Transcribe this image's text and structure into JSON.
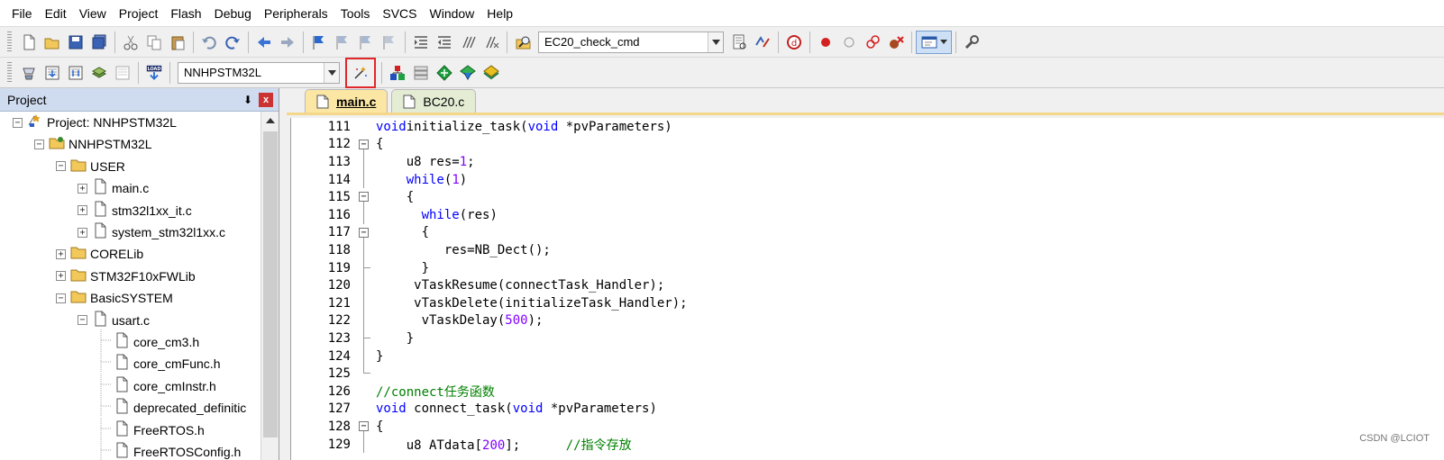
{
  "menubar": [
    "File",
    "Edit",
    "View",
    "Project",
    "Flash",
    "Debug",
    "Peripherals",
    "Tools",
    "SVCS",
    "Window",
    "Help"
  ],
  "toolbar1": {
    "target_combo": "EC20_check_cmd",
    "icons_left": [
      "new-file-icon",
      "open-folder-icon",
      "save-icon",
      "save-all-icon",
      "cut-icon",
      "copy-icon",
      "paste-icon",
      "undo-icon",
      "redo-icon",
      "navigate-back-icon",
      "navigate-forward-icon",
      "bookmark-set-icon",
      "bookmark-prev-icon",
      "bookmark-next-icon",
      "bookmark-clear-icon",
      "indent-icon",
      "unindent-icon",
      "comment-icon",
      "uncomment-icon",
      "find-in-files-icon"
    ],
    "icons_right": [
      "incremental-find-icon",
      "find-replace-icon",
      "debug-session-icon",
      "breakpoint-insert-icon",
      "breakpoint-disable-icon",
      "breakpoint-disable-all-icon",
      "breakpoint-kill-all-icon",
      "window-layout-icon",
      "configure-icon"
    ]
  },
  "toolbar2": {
    "target_combo": "NNHPSTM32L",
    "load_label": "LOAD",
    "icons_left": [
      "translate-icon",
      "build-icon",
      "rebuild-icon",
      "batch-build-icon",
      "stop-build-icon",
      "download-icon"
    ],
    "icons_right": [
      "options-for-target-icon",
      "manage-project-items-icon",
      "manage-run-time-environment-icon",
      "select-software-packs-icon",
      "pack-installer-icon",
      "books-icon"
    ]
  },
  "project": {
    "title": "Project",
    "pin": "⬇",
    "close": "x",
    "items": [
      {
        "label": "Project: NNHPSTM32L",
        "level": 0,
        "toggle": "-",
        "icon": "project-icon"
      },
      {
        "label": "NNHPSTM32L",
        "level": 1,
        "toggle": "-",
        "icon": "target-icon"
      },
      {
        "label": "USER",
        "level": 2,
        "toggle": "-",
        "icon": "folder-icon"
      },
      {
        "label": "main.c",
        "level": 3,
        "toggle": "+",
        "icon": "file-icon"
      },
      {
        "label": "stm32l1xx_it.c",
        "level": 3,
        "toggle": "+",
        "icon": "file-icon"
      },
      {
        "label": "system_stm32l1xx.c",
        "level": 3,
        "toggle": "+",
        "icon": "file-icon"
      },
      {
        "label": "CORELib",
        "level": 2,
        "toggle": "+",
        "icon": "folder-icon"
      },
      {
        "label": "STM32F10xFWLib",
        "level": 2,
        "toggle": "+",
        "icon": "folder-icon"
      },
      {
        "label": "BasicSYSTEM",
        "level": 2,
        "toggle": "-",
        "icon": "folder-icon"
      },
      {
        "label": "usart.c",
        "level": 3,
        "toggle": "-",
        "icon": "file-icon"
      },
      {
        "label": "core_cm3.h",
        "level": 4,
        "toggle": "",
        "icon": "header-file-icon"
      },
      {
        "label": "core_cmFunc.h",
        "level": 4,
        "toggle": "",
        "icon": "header-file-icon"
      },
      {
        "label": "core_cmInstr.h",
        "level": 4,
        "toggle": "",
        "icon": "header-file-icon"
      },
      {
        "label": "deprecated_definitic",
        "level": 4,
        "toggle": "",
        "icon": "header-file-icon"
      },
      {
        "label": "FreeRTOS.h",
        "level": 4,
        "toggle": "",
        "icon": "header-file-icon"
      },
      {
        "label": "FreeRTOSConfig.h",
        "level": 4,
        "toggle": "",
        "icon": "header-file-icon"
      }
    ]
  },
  "tabs": [
    {
      "label": "main.c",
      "active": true
    },
    {
      "label": "BC20.c",
      "active": false
    }
  ],
  "code": [
    {
      "n": "111",
      "fold": "",
      "t": [
        [
          "kw",
          "void"
        ],
        [
          "",
          "initialize_task("
        ],
        [
          "kw",
          "void"
        ],
        [
          "",
          " *pvParameters)"
        ]
      ]
    },
    {
      "n": "112",
      "fold": "open",
      "t": [
        [
          "",
          "{"
        ]
      ]
    },
    {
      "n": "113",
      "fold": "line",
      "t": [
        [
          "",
          "    u8 res="
        ],
        [
          "num",
          "1"
        ],
        [
          "",
          ";"
        ]
      ]
    },
    {
      "n": "114",
      "fold": "line",
      "t": [
        [
          "",
          "    "
        ],
        [
          "kw",
          "while"
        ],
        [
          "",
          "("
        ],
        [
          "num",
          "1"
        ],
        [
          "",
          ")"
        ]
      ]
    },
    {
      "n": "115",
      "fold": "open",
      "t": [
        [
          "",
          "    {"
        ]
      ]
    },
    {
      "n": "116",
      "fold": "line",
      "t": [
        [
          "",
          "      "
        ],
        [
          "kw",
          "while"
        ],
        [
          "",
          "(res)"
        ]
      ]
    },
    {
      "n": "117",
      "fold": "open",
      "t": [
        [
          "",
          "      {"
        ]
      ]
    },
    {
      "n": "118",
      "fold": "line",
      "t": [
        [
          "",
          "         res=NB_Dect();"
        ]
      ]
    },
    {
      "n": "119",
      "fold": "end",
      "t": [
        [
          "",
          "      }"
        ]
      ]
    },
    {
      "n": "120",
      "fold": "line",
      "t": [
        [
          "",
          "     vTaskResume(connectTask_Handler);"
        ]
      ]
    },
    {
      "n": "121",
      "fold": "line",
      "t": [
        [
          "",
          "     vTaskDelete(initializeTask_Handler);"
        ]
      ]
    },
    {
      "n": "122",
      "fold": "line",
      "t": [
        [
          "",
          "      vTaskDelay("
        ],
        [
          "num",
          "500"
        ],
        [
          "",
          ");"
        ]
      ]
    },
    {
      "n": "123",
      "fold": "end",
      "t": [
        [
          "",
          "    }"
        ]
      ]
    },
    {
      "n": "124",
      "fold": "line",
      "t": [
        [
          "",
          "}"
        ]
      ]
    },
    {
      "n": "125",
      "fold": "endlast",
      "t": []
    },
    {
      "n": "126",
      "fold": "",
      "t": [
        [
          "cm",
          "//connect任务函数"
        ]
      ]
    },
    {
      "n": "127",
      "fold": "",
      "t": [
        [
          "kw",
          "void"
        ],
        [
          "",
          " connect_task("
        ],
        [
          "kw",
          "void"
        ],
        [
          "",
          " *pvParameters)"
        ]
      ]
    },
    {
      "n": "128",
      "fold": "open",
      "t": [
        [
          "",
          "{"
        ]
      ]
    },
    {
      "n": "129",
      "fold": "line",
      "t": [
        [
          "",
          "    u8 ATdata["
        ],
        [
          "num",
          "200"
        ],
        [
          "",
          "];      "
        ],
        [
          "cm",
          "//指令存放"
        ]
      ]
    }
  ],
  "watermark": "CSDN @LCIOT"
}
